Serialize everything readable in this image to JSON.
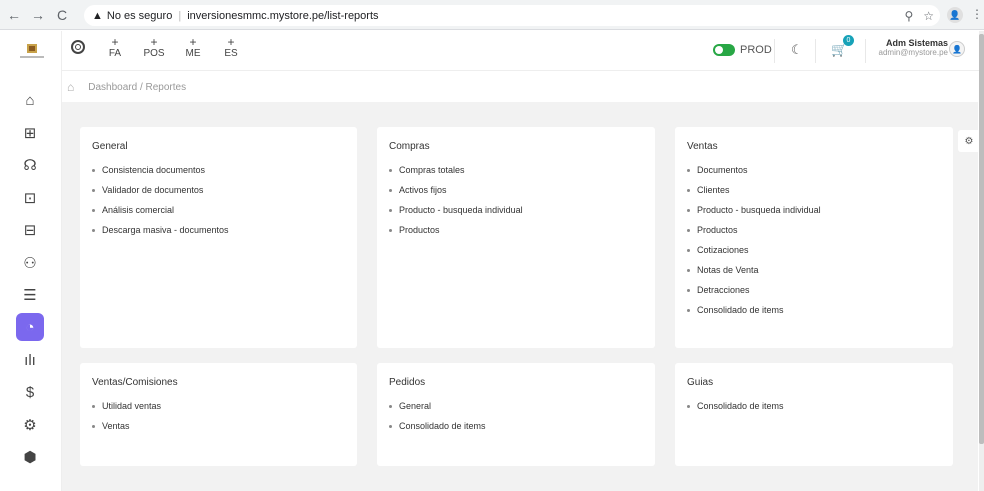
{
  "browser": {
    "back": "←",
    "forward": "→",
    "reload": "C",
    "warning_icon": "▲",
    "security_text": "No es seguro",
    "url": "inversionesmmc.mystore.pe/list-reports",
    "zoom_icon": "⚲",
    "star_icon": "☆",
    "profile_icon": "👤",
    "menu_icon": "⋮"
  },
  "header": {
    "quick_actions": [
      {
        "plus": "+",
        "label": "FA"
      },
      {
        "plus": "+",
        "label": "POS"
      },
      {
        "plus": "+",
        "label": "ME"
      },
      {
        "plus": "+",
        "label": "ES"
      }
    ],
    "env_label": "PROD",
    "moon_icon": "☾",
    "cart_icon": "🛒",
    "cart_count": "0",
    "user_name": "Adm Sistemas",
    "user_email": "admin@mystore.pe",
    "avatar_icon": "👤"
  },
  "breadcrumb": {
    "home_icon": "⌂",
    "path": "Dashboard / Reportes"
  },
  "sidebar": {
    "items": [
      {
        "icon": "⌂",
        "name": "home"
      },
      {
        "icon": "⊞",
        "name": "dashboard"
      },
      {
        "icon": "☊",
        "name": "users"
      },
      {
        "icon": "⊡",
        "name": "shop"
      },
      {
        "icon": "⊟",
        "name": "inventory"
      },
      {
        "icon": "⚇",
        "name": "persons"
      },
      {
        "icon": "☰",
        "name": "documents"
      },
      {
        "icon": "◔",
        "name": "reports"
      },
      {
        "icon": "ılı",
        "name": "stats"
      },
      {
        "icon": "$",
        "name": "finance"
      },
      {
        "icon": "⚙",
        "name": "settings"
      },
      {
        "icon": "⬢",
        "name": "modules"
      }
    ]
  },
  "cards": [
    {
      "title": "General",
      "items": [
        "Consistencia documentos",
        "Validador de documentos",
        "Análisis comercial",
        "Descarga masiva - documentos"
      ]
    },
    {
      "title": "Compras",
      "items": [
        "Compras totales",
        "Activos fijos",
        "Producto - busqueda individual",
        "Productos"
      ]
    },
    {
      "title": "Ventas",
      "items": [
        "Documentos",
        "Clientes",
        "Producto - busqueda individual",
        "Productos",
        "Cotizaciones",
        "Notas de Venta",
        "Detracciones",
        "Consolidado de items"
      ]
    },
    {
      "title": "Ventas/Comisiones",
      "items": [
        "Utilidad ventas",
        "Ventas"
      ]
    },
    {
      "title": "Pedidos",
      "items": [
        "General",
        "Consolidado de items"
      ]
    },
    {
      "title": "Guias",
      "items": [
        "Consolidado de items"
      ]
    }
  ],
  "gear_icon": "⚙"
}
